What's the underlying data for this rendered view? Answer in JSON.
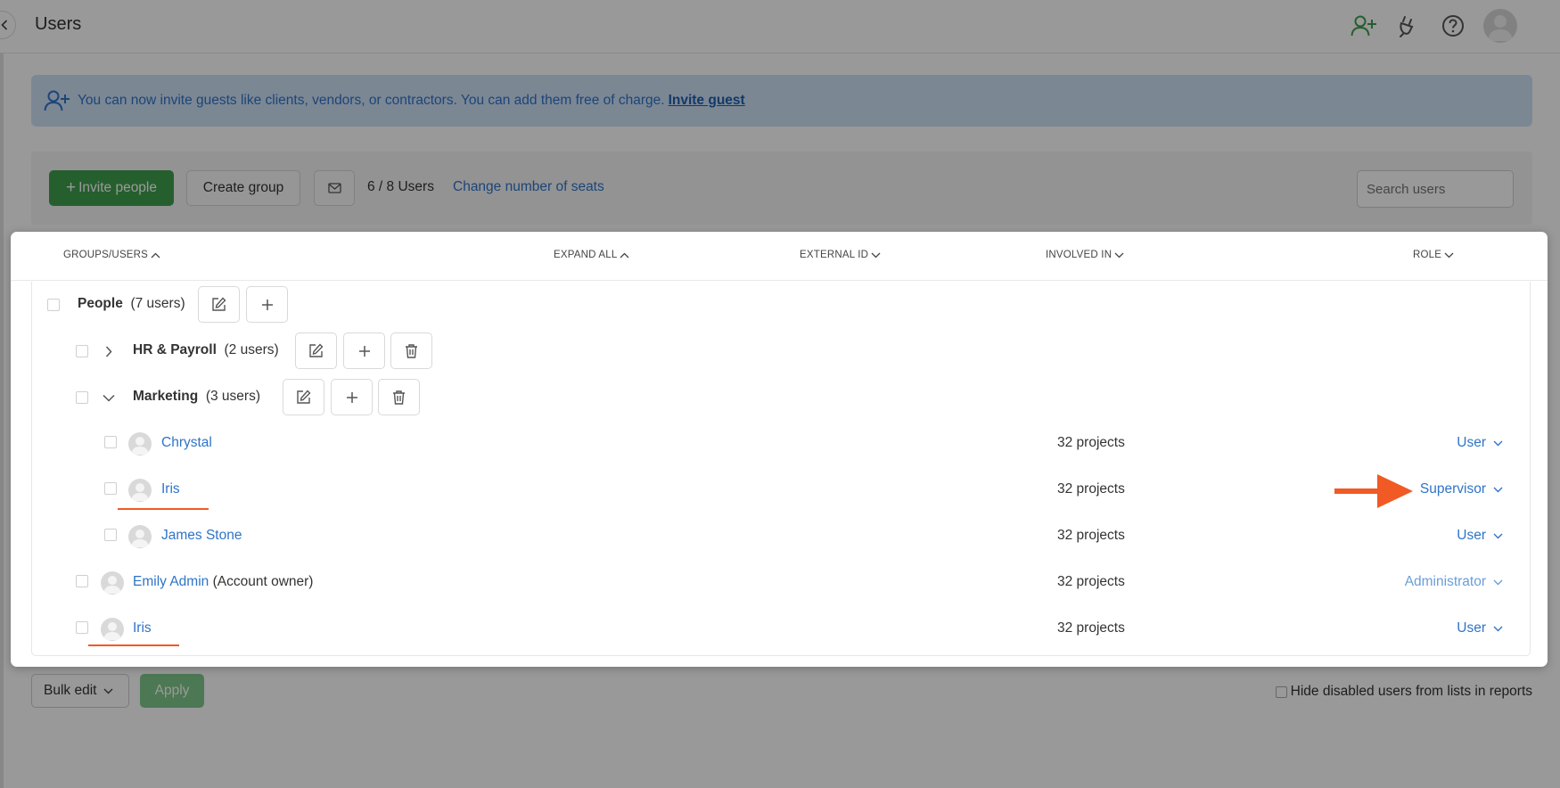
{
  "header": {
    "title": "Users"
  },
  "banner": {
    "text": "You can now invite guests like clients, vendors, or contractors. You can add them free of charge.",
    "link": "Invite guest"
  },
  "toolbar": {
    "invite_label": "Invite people",
    "create_group_label": "Create group",
    "user_count": "6 / 8 Users",
    "change_seats_label": "Change number of seats",
    "search_placeholder": "Search users"
  },
  "table": {
    "headers": {
      "groups_users": "GROUPS/USERS",
      "expand_all": "EXPAND ALL",
      "external_id": "EXTERNAL ID",
      "involved_in": "INVOLVED IN",
      "role": "ROLE"
    },
    "groups": [
      {
        "name": "People",
        "count": "(7 users)"
      },
      {
        "name": "HR & Payroll",
        "count": "(2 users)"
      },
      {
        "name": "Marketing",
        "count": "(3 users)"
      }
    ],
    "users": [
      {
        "name": "Chrystal",
        "note": "",
        "involved": "32 projects",
        "role": "User"
      },
      {
        "name": "Iris",
        "note": "",
        "involved": "32 projects",
        "role": "Supervisor"
      },
      {
        "name": "James Stone",
        "note": "",
        "involved": "32 projects",
        "role": "User"
      },
      {
        "name": "Emily Admin",
        "note": "(Account owner)",
        "involved": "32 projects",
        "role": "Administrator"
      },
      {
        "name": "Iris",
        "note": "",
        "involved": "32 projects",
        "role": "User"
      }
    ]
  },
  "footer": {
    "bulk_edit_label": "Bulk edit",
    "apply_label": "Apply",
    "hide_disabled_label": "Hide disabled users from lists in reports"
  },
  "colors": {
    "brand_green": "#3f9e4d",
    "link_blue": "#2f74c8",
    "annotation_orange": "#f15a24"
  }
}
